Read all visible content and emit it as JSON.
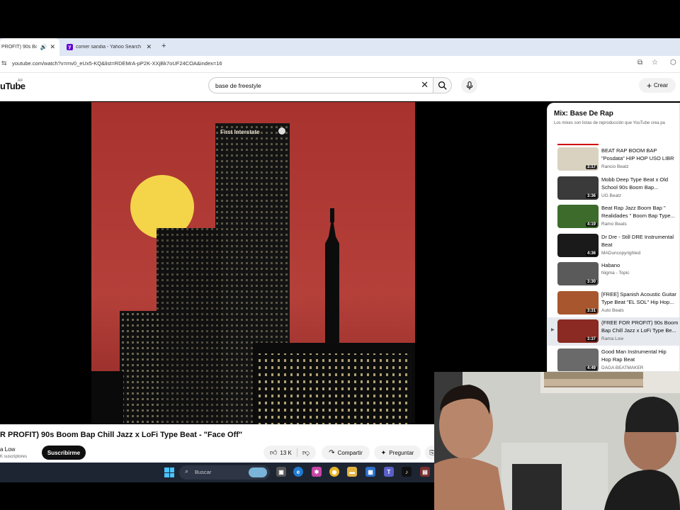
{
  "browser": {
    "tabs": [
      {
        "label": "PROFIT) 90s Boo",
        "active": true
      },
      {
        "label": "comer sandia - Yahoo Search",
        "active": false
      }
    ],
    "new_tab_label": "+",
    "url": "youtube.com/watch?v=mv0_eUx5-KQ&list=RDEMrA-pP2K-XXjBk7oUF24COA&index=16"
  },
  "youtube": {
    "logo_text": "uTube",
    "logo_country": "AR",
    "search_value": "base de freestyle",
    "create_label": "Crear"
  },
  "video": {
    "title": "R PROFIT) 90s Boom Bap Chill Jazz x LoFi Type Beat - \"Face Off\"",
    "channel": "a Low",
    "subscribers": "K suscriptores",
    "subscribe_label": "Suscribirme",
    "likes": "13 K",
    "share_label": "Compartir",
    "ask_label": "Preguntar",
    "thumbnail_text": "First Interstate"
  },
  "playlist": {
    "title": "Mix: Base De Rap",
    "subtitle": "Los mixes son listas de reproducción que YouTube crea pa",
    "items": [
      {
        "title": "BEAT RAP BOOM BAP\n\"Posdata\" HIP HOP USO LIBR",
        "author": "Rancio Beatz",
        "duration": "3:17",
        "bg": "#d9d2c0",
        "current": false
      },
      {
        "title": "Mobb Deep Type Beat x Old\nSchool 90s Boom Bap...",
        "author": "UG Beatz",
        "duration": "3:36",
        "bg": "#3a3a3a",
        "current": false
      },
      {
        "title": "Beat Rap Jazz Boom Bap \"\nRealidades \" Boom Bap Type...",
        "author": "Ramo Beats",
        "duration": "4:19",
        "bg": "#3d6b2c",
        "current": false
      },
      {
        "title": "Dr Dre - Still DRE Instrumental\nBeat",
        "author": "MADuncopyrighted",
        "duration": "4:36",
        "bg": "#1a1a1a",
        "current": false
      },
      {
        "title": "Habano",
        "author": "Nigma - Topic",
        "duration": "3:30",
        "bg": "#5a5a5a",
        "current": false
      },
      {
        "title": "[FREE] Spanish Acoustic Guitar\nType Beat \"EL SOL\" Hip Hop...",
        "author": "Auto Beats",
        "duration": "3:31",
        "bg": "#a8562d",
        "current": false
      },
      {
        "title": "(FREE FOR PROFIT) 90s Boom\nBap Chill Jazz x LoFi Type Be...",
        "author": "Rama Low",
        "duration": "3:37",
        "bg": "#8a2a22",
        "current": true
      },
      {
        "title": "Good Man Instrumental Hip\nHop Rap Beat",
        "author": "DAGA BEATMAKER",
        "duration": "4:49",
        "bg": "#6a6a6a",
        "current": false
      }
    ]
  },
  "taskbar": {
    "search_placeholder": "Buscar"
  },
  "colors": {
    "youtube_red": "#cc0000",
    "sky_top": "#a8322e",
    "sun": "#f4d54a",
    "taskbar": "#1d2533"
  }
}
